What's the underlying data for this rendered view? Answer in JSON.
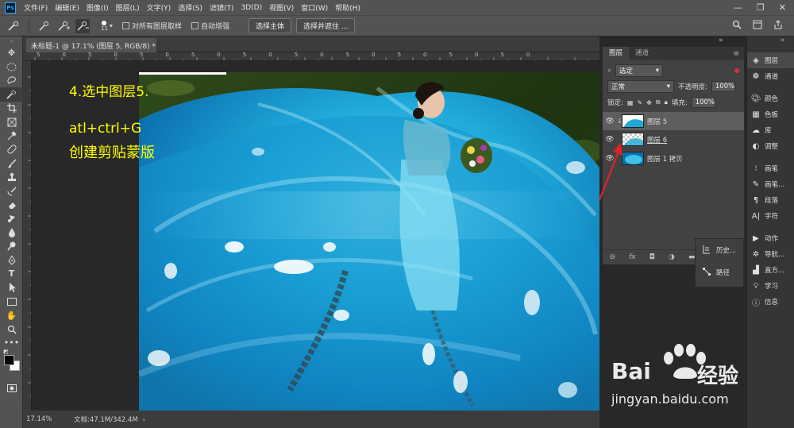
{
  "menubar": {
    "logo": "Ps",
    "items": [
      "文件(F)",
      "编辑(E)",
      "图像(I)",
      "图层(L)",
      "文字(Y)",
      "选择(S)",
      "滤镜(T)",
      "3D(D)",
      "视图(V)",
      "窗口(W)",
      "帮助(H)"
    ],
    "minimize": "—",
    "maximize": "❐",
    "close": "✕"
  },
  "options": {
    "brush_size": "11",
    "sample_all_label": "对所有图层取样",
    "auto_enhance_label": "自动增强",
    "select_subject": "选择主体",
    "select_and_mask": "选择并遮住 ..."
  },
  "document": {
    "tab_title": "未标题-1 @ 17.1% (图层 5, RGB/8) *",
    "tab_close": "×",
    "zoom": "17.14%",
    "doc_info": "文档:47.1M/342.4M",
    "ruler_marks": [
      "5",
      "0",
      "5",
      "0",
      "5",
      "0",
      "5",
      "0",
      "5",
      "0",
      "5",
      "0",
      "5",
      "0",
      "5",
      "0",
      "5",
      "0",
      "5",
      "0"
    ]
  },
  "annotations": {
    "step": "4.选中图层5.",
    "shortcut": "atl+ctrl+G",
    "action": "创建剪贴蒙版"
  },
  "layers_panel": {
    "tabs": [
      "图层",
      "通道"
    ],
    "filter_kind": "选定",
    "blend_mode": "正常",
    "opacity_label": "不透明度:",
    "opacity_value": "100%",
    "lock_label": "锁定:",
    "fill_label": "填充:",
    "fill_value": "100%",
    "layers": [
      {
        "name": "图层 5",
        "selected": true
      },
      {
        "name": "图层 6",
        "selected": false
      },
      {
        "name": "图层 1 拷贝",
        "selected": false
      }
    ],
    "footer_icons": [
      "link-icon",
      "fx-icon",
      "mask-icon",
      "adjustment-icon",
      "folder-icon",
      "new-layer-icon",
      "trash-icon"
    ]
  },
  "mini_panel": {
    "history": "历史...",
    "paths": "路径"
  },
  "side_panel": {
    "groups": [
      [
        "图层",
        "通道"
      ],
      [
        "颜色",
        "色板",
        "库",
        "调整"
      ],
      [
        "画笔",
        "画笔...",
        "段落",
        "字符"
      ],
      [
        "动作",
        "导航...",
        "直方...",
        "学习",
        "信息"
      ]
    ]
  },
  "watermark": {
    "brand": "Bai",
    "brand_cn": "经验",
    "url": "jingyan.baidu.com"
  },
  "colors": {
    "accent": "#31a8ff",
    "annotation": "#ffff00",
    "arrow": "#e0222a"
  }
}
